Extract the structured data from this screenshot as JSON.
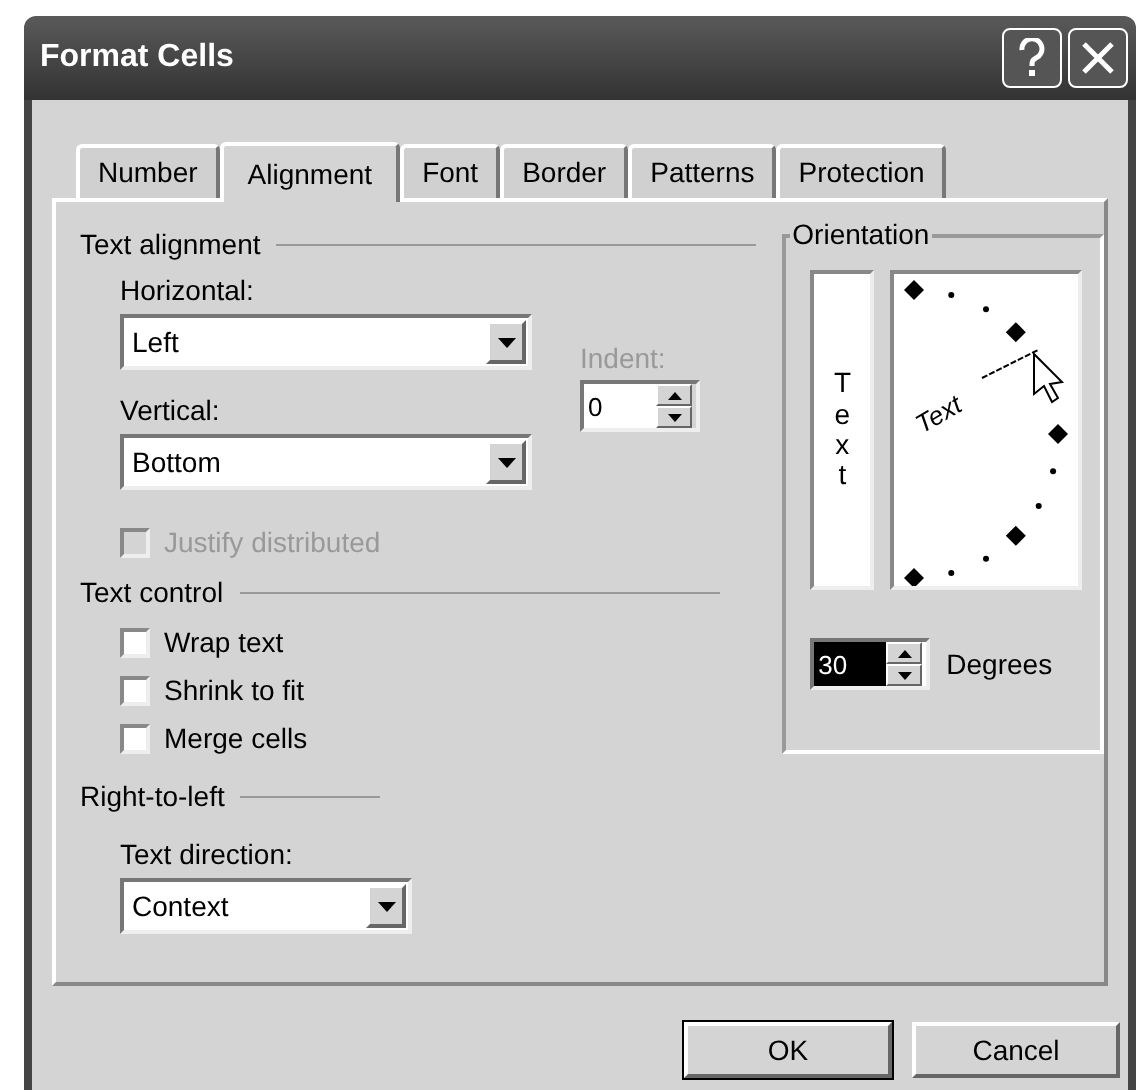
{
  "window": {
    "title": "Format Cells"
  },
  "tabs": [
    {
      "label": "Number",
      "selected": false
    },
    {
      "label": "Alignment",
      "selected": true
    },
    {
      "label": "Font",
      "selected": false
    },
    {
      "label": "Border",
      "selected": false
    },
    {
      "label": "Patterns",
      "selected": false
    },
    {
      "label": "Protection",
      "selected": false
    }
  ],
  "text_alignment": {
    "heading": "Text alignment",
    "horizontal": {
      "label": "Horizontal:",
      "value": "Left"
    },
    "vertical": {
      "label": "Vertical:",
      "value": "Bottom"
    },
    "indent": {
      "label": "Indent:",
      "value": "0",
      "disabled": true
    },
    "justify_distributed": {
      "label": "Justify distributed",
      "checked": false,
      "disabled": true
    }
  },
  "text_control": {
    "heading": "Text control",
    "options": [
      {
        "label": "Wrap text",
        "checked": false
      },
      {
        "label": "Shrink to fit",
        "checked": false
      },
      {
        "label": "Merge cells",
        "checked": false
      }
    ]
  },
  "right_to_left": {
    "heading": "Right-to-left",
    "text_direction": {
      "label": "Text direction:",
      "value": "Context"
    }
  },
  "orientation": {
    "heading": "Orientation",
    "vertical_text": "Text",
    "dial_text": "Text",
    "degrees": {
      "value": "30",
      "label": "Degrees"
    }
  },
  "buttons": [
    {
      "label": "OK",
      "default": true
    },
    {
      "label": "Cancel",
      "default": false
    }
  ]
}
